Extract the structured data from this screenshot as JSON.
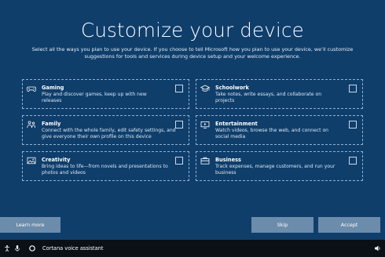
{
  "title": "Customize your device",
  "subtitle": "Select all the ways you plan to use your device. If you choose to tell Microsoft how you plan to use your device, we’ll customize suggestions for tools and services during device setup and your welcome experience.",
  "cards": [
    {
      "name": "Gaming",
      "desc": "Play and discover games, keep up with new releases",
      "icon": "gamepad-icon",
      "checked": false
    },
    {
      "name": "Schoolwork",
      "desc": "Take notes, write essays, and collaborate on projects",
      "icon": "graduation-cap-icon",
      "checked": false
    },
    {
      "name": "Family",
      "desc": "Connect with the whole family, edit safety settings, and give everyone their own profile on this device",
      "icon": "family-icon",
      "checked": false
    },
    {
      "name": "Entertainment",
      "desc": "Watch videos, browse the web, and connect on social media",
      "icon": "video-icon",
      "checked": false
    },
    {
      "name": "Creativity",
      "desc": "Bring ideas to life—from novels and presentations to photos and videos",
      "icon": "image-icon",
      "checked": false
    },
    {
      "name": "Business",
      "desc": "Track expenses, manage customers, and run your business",
      "icon": "briefcase-icon",
      "checked": false
    }
  ],
  "buttons": {
    "learn_more": "Learn more",
    "skip": "Skip",
    "accept": "Accept"
  },
  "taskbar": {
    "cortana": "Cortana voice assistant"
  },
  "colors": {
    "background": "#0f3e6b",
    "button": "#6c8cab",
    "taskbar": "#0a1016"
  }
}
